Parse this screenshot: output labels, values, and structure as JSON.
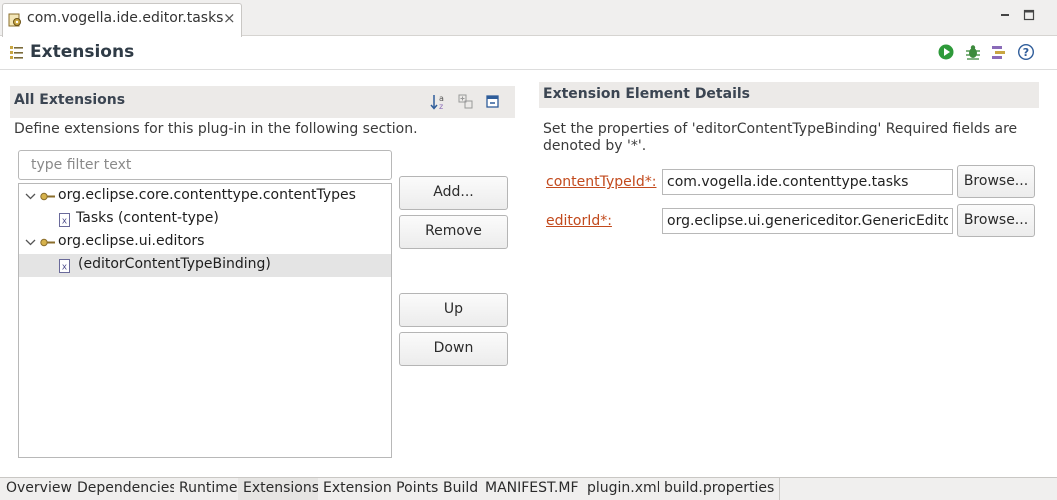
{
  "editor_tab": {
    "title": "com.vogella.ide.editor.tasks",
    "close_glyph": "×",
    "icon": "plugin-manifest-icon"
  },
  "window_controls": {
    "minimize_icon": "minimize-icon",
    "maximize_icon": "maximize-icon"
  },
  "page": {
    "title": "Extensions",
    "icon": "extensions-icon"
  },
  "toolbar": {
    "icons": [
      "run-icon",
      "debug-icon",
      "export-icon",
      "help-icon"
    ]
  },
  "all_extensions": {
    "title": "All Extensions",
    "description": "Define extensions for this plug-in in the following section.",
    "filter_placeholder": "type filter text",
    "tree": [
      {
        "label": "org.eclipse.core.contenttype.contentTypes",
        "level": 0,
        "expanded": true,
        "icon": "extension-point-icon"
      },
      {
        "label": "Tasks (content-type)",
        "level": 1,
        "icon": "xml-element-icon"
      },
      {
        "label": "org.eclipse.ui.editors",
        "level": 0,
        "expanded": true,
        "icon": "extension-point-icon"
      },
      {
        "label": "(editorContentTypeBinding)",
        "level": 1,
        "icon": "xml-element-icon",
        "selected": true
      }
    ],
    "buttons": {
      "add": "Add...",
      "remove": "Remove",
      "up": "Up",
      "down": "Down"
    }
  },
  "details": {
    "title": "Extension Element Details",
    "description_line1": "Set the properties of 'editorContentTypeBinding' Required fields are",
    "description_line2": "denoted by '*'.",
    "fields": [
      {
        "label": "contentTypeId*:",
        "value": "com.vogella.ide.contenttype.tasks",
        "browse": "Browse..."
      },
      {
        "label": "editorId*:",
        "value": "org.eclipse.ui.genericeditor.GenericEditor",
        "browse": "Browse..."
      }
    ]
  },
  "bottom_tabs": [
    "Overview",
    "Dependencies",
    "Runtime",
    "Extensions",
    "Extension Points",
    "Build",
    "MANIFEST.MF",
    "plugin.xml",
    "build.properties"
  ],
  "active_tab": "Extensions",
  "colors": {
    "required_label": "#c24a1d",
    "section_bar": "#eceae8",
    "selection": "#e4e4e4"
  }
}
